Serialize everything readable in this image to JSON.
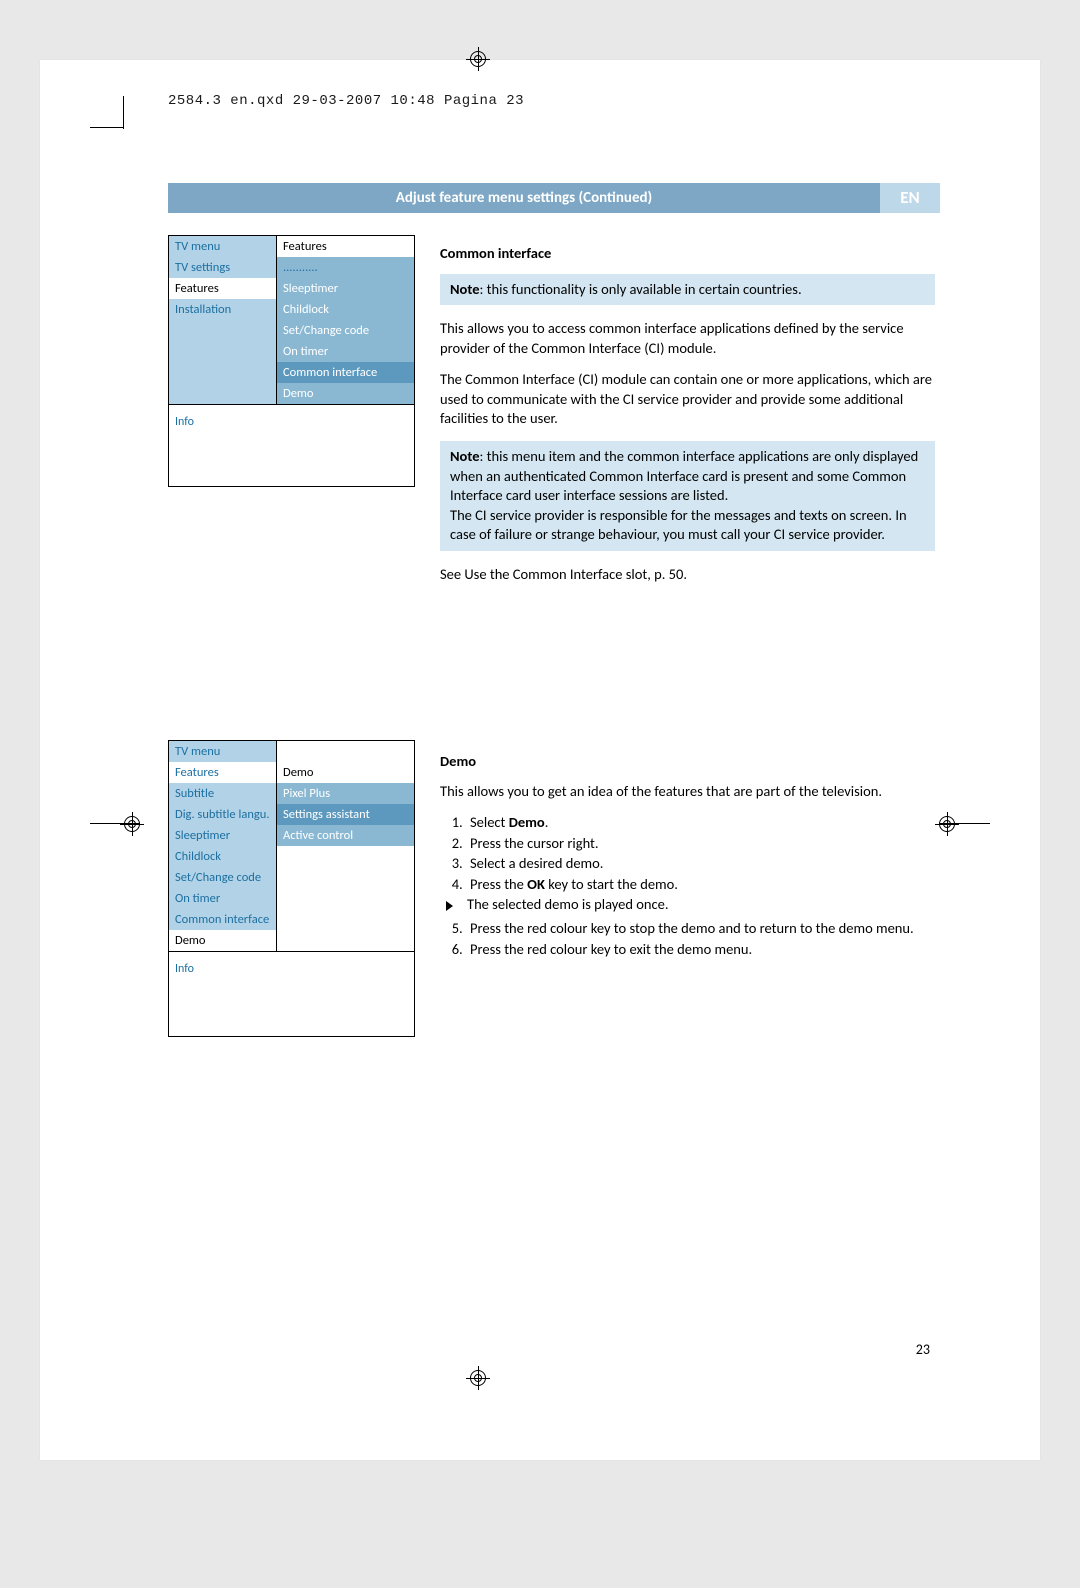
{
  "header_line": "2584.3 en.qxd  29-03-2007  10:48  Pagina 23",
  "title_bar": {
    "main": "Adjust feature menu settings  (Continued)",
    "lang": "EN"
  },
  "page_number": "23",
  "panel1": {
    "rows": [
      {
        "l": "TV menu",
        "r": "Features",
        "l_cls": "bg-lt tx-blue",
        "r_cls": "bg-white tx-black"
      },
      {
        "l": "TV settings",
        "r": "...........",
        "l_cls": "bg-lt tx-blue",
        "r_cls": "bg-md tx-blue"
      },
      {
        "l": "Features",
        "r": "Sleeptimer",
        "l_cls": "bg-white tx-black",
        "r_cls": "bg-md tx-white"
      },
      {
        "l": "Installation",
        "r": "Childlock",
        "l_cls": "bg-lt tx-blue",
        "r_cls": "bg-md tx-white"
      },
      {
        "l": "",
        "r": "Set/Change code",
        "l_cls": "bg-lt tx-blue",
        "r_cls": "bg-md tx-white"
      },
      {
        "l": "",
        "r": "On timer",
        "l_cls": "bg-lt tx-blue",
        "r_cls": "bg-md tx-white"
      },
      {
        "l": "",
        "r": "Common interface",
        "l_cls": "bg-lt tx-blue",
        "r_cls": "bg-dk tx-white"
      },
      {
        "l": "",
        "r": "Demo",
        "l_cls": "bg-lt tx-blue",
        "r_cls": "bg-md tx-white"
      }
    ],
    "info": "Info"
  },
  "panel2": {
    "rows": [
      {
        "l": "TV menu",
        "r": "",
        "l_cls": "bg-lt tx-blue",
        "r_cls": "bg-white"
      },
      {
        "l": "Features",
        "r": "Demo",
        "l_cls": "bg-white tx-blue",
        "r_cls": "bg-white tx-black"
      },
      {
        "l": "Subtitle",
        "r": "Pixel Plus",
        "l_cls": "bg-lt tx-blue",
        "r_cls": "bg-md tx-white"
      },
      {
        "l": "Dig. subtitle langu.",
        "r": "Settings assistant",
        "l_cls": "bg-lt tx-blue",
        "r_cls": "bg-dk tx-white"
      },
      {
        "l": "Sleeptimer",
        "r": "Active control",
        "l_cls": "bg-lt tx-blue",
        "r_cls": "bg-md tx-white"
      },
      {
        "l": "Childlock",
        "r": "",
        "l_cls": "bg-lt tx-blue",
        "r_cls": "bg-white"
      },
      {
        "l": "Set/Change code",
        "r": "",
        "l_cls": "bg-lt tx-blue",
        "r_cls": "bg-white"
      },
      {
        "l": "On timer",
        "r": "",
        "l_cls": "bg-lt tx-blue",
        "r_cls": "bg-white"
      },
      {
        "l": "Common interface",
        "r": "",
        "l_cls": "bg-lt tx-blue",
        "r_cls": "bg-white"
      },
      {
        "l": "Demo",
        "r": "",
        "l_cls": "bg-white tx-black",
        "r_cls": "bg-white"
      }
    ],
    "info": "Info"
  },
  "section_ci": {
    "heading": "Common interface",
    "note1_prefix": "Note",
    "note1_rest": ": this functionality is only available in certain countries.",
    "para1": "This allows you to access common interface applications defined by the service provider of the Common Interface (CI) module.",
    "para2": "The Common Interface (CI) module can contain one or more applications, which are used to communicate with the CI service provider and provide some additional facilities to the user.",
    "note2_prefix": "Note",
    "note2_rest": ": this menu item and the common interface applications are only displayed when an authenticated Common Interface card is present and some Common Interface card user interface sessions are listed.\nThe CI service provider is responsible for the messages and texts on screen. In case of failure or strange behaviour, you must call your CI service provider.",
    "para3": "See Use the Common Interface slot, p. 50."
  },
  "section_demo": {
    "heading": "Demo",
    "intro": "This allows you to get an idea of the features that are part of the television.",
    "step1_pre": "Select ",
    "step1_bold": "Demo",
    "step1_post": ".",
    "step2": "Press the cursor right.",
    "step3": "Select a desired demo.",
    "step4_pre": "Press the ",
    "step4_bold": "OK",
    "step4_post": " key to start the demo.",
    "result": "The selected demo is played once.",
    "step5": "Press the red colour key to stop the demo and to return to the demo menu.",
    "step6": "Press the red colour key to exit the demo menu."
  }
}
